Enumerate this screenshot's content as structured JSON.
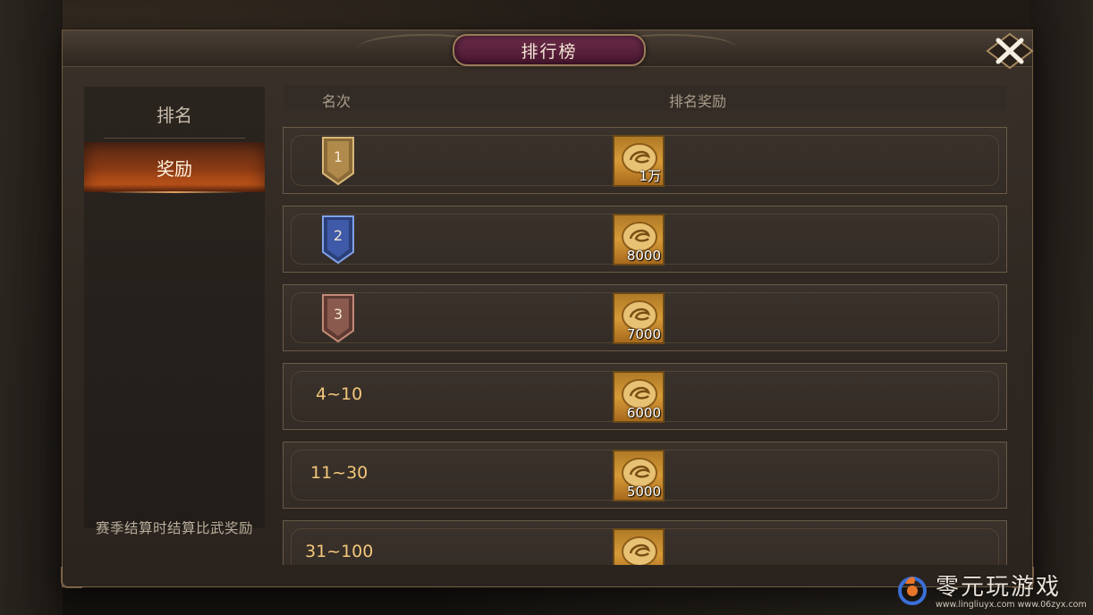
{
  "title": "排行榜",
  "sidebar": {
    "tabs": [
      {
        "label": "排名",
        "active": false
      },
      {
        "label": "奖励",
        "active": true
      }
    ],
    "note": "赛季结算时结算比武奖励"
  },
  "table": {
    "headers": {
      "rank": "名次",
      "reward": "排名奖励"
    },
    "rows": [
      {
        "rank": "1",
        "badge": "gold",
        "reward_count": "1万"
      },
      {
        "rank": "2",
        "badge": "blue",
        "reward_count": "8000"
      },
      {
        "rank": "3",
        "badge": "bronze",
        "reward_count": "7000"
      },
      {
        "rank": "4~10",
        "badge": null,
        "reward_count": "6000"
      },
      {
        "rank": "11~30",
        "badge": null,
        "reward_count": "5000"
      },
      {
        "rank": "31~100",
        "badge": null,
        "reward_count": ""
      }
    ]
  },
  "watermark": {
    "name": "零元玩游戏",
    "urls": "www.lingliuyx.com  www.06zyx.com"
  },
  "colors": {
    "gold_badge": "#b08a4a",
    "blue_badge": "#3e5aa8",
    "bronze_badge": "#8a5a4e",
    "rank_text": "#f3c77c",
    "title_plate": "#6b2c4a"
  },
  "icons": {
    "close": "close-x-icon",
    "reward": "gold-coin-icon"
  }
}
